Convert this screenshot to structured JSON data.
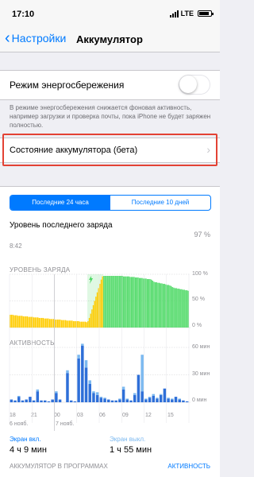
{
  "status_bar": {
    "time": "17:10",
    "network": "LTE"
  },
  "nav": {
    "back_label": "Настройки",
    "title": "Аккумулятор"
  },
  "low_power": {
    "label": "Режим энергосбережения",
    "enabled": false,
    "description": "В режиме энергосбережения снижается фоновая активность, например загрузки и проверка почты, пока iPhone не будет заряжен полностью."
  },
  "battery_health": {
    "label": "Состояние аккумулятора (бета)"
  },
  "segments": [
    {
      "label": "Последние 24 часа",
      "active": true
    },
    {
      "label": "Последние 10 дней",
      "active": false
    }
  ],
  "last_charge": {
    "title": "Уровень последнего заряда",
    "time": "8:42",
    "percent": "97 %"
  },
  "colors": {
    "accent": "#007aff",
    "highlight": "#e34234",
    "charge_green": "#4cd964",
    "charge_yellow": "#ffcc00",
    "activity_dark": "#2e6fd8",
    "activity_light": "#7cb9f0"
  },
  "chart_data": [
    {
      "type": "bar",
      "title": "УРОВЕНЬ ЗАРЯДА",
      "y_ticks": [
        "100 %",
        "50 %",
        "0 %"
      ],
      "ylim": [
        0,
        100
      ],
      "series": [
        {
          "values": [
            24,
            24,
            24,
            23,
            23,
            23,
            22,
            22,
            22,
            22,
            21,
            21,
            21,
            21,
            20,
            20,
            20,
            20,
            19,
            19,
            19,
            19,
            18,
            18,
            18,
            18,
            17,
            17,
            17,
            17,
            16,
            16,
            16,
            16,
            15,
            15,
            15,
            15,
            15,
            14,
            14,
            14,
            14,
            13,
            13,
            13,
            13,
            13,
            12,
            12,
            12,
            12,
            12,
            11,
            11,
            11,
            11,
            11,
            10,
            12,
            18,
            26,
            34,
            42,
            50,
            58,
            66,
            74,
            82,
            90,
            96,
            97,
            97,
            97,
            97,
            97,
            97,
            97,
            97,
            97,
            97,
            97,
            97,
            97,
            97,
            97,
            96,
            96,
            96,
            96,
            96,
            95,
            95,
            95,
            95,
            94,
            94,
            94,
            93,
            93,
            93,
            92,
            92,
            92,
            91,
            91,
            91,
            90,
            88,
            86,
            85,
            85,
            84,
            84,
            83,
            83,
            82,
            82,
            81,
            80,
            80,
            79,
            78,
            76,
            75,
            74,
            74,
            73,
            73,
            72,
            72,
            71,
            71,
            70,
            70,
            69
          ]
        }
      ],
      "charging_markers": [
        "charging-bolt"
      ]
    },
    {
      "type": "bar",
      "title": "АКТИВНОСТЬ",
      "y_ticks": [
        "60 мин",
        "30 мин",
        "0 мин"
      ],
      "ylim": [
        0,
        60
      ],
      "x_ticks": [
        "18",
        "21",
        "00",
        "03",
        "06",
        "09",
        "12",
        "15"
      ],
      "date_labels": [
        "6 нояб.",
        "7 нояб."
      ],
      "series": [
        {
          "name": "Экран вкл.",
          "values": [
            3,
            2,
            6,
            2,
            3,
            6,
            2,
            12,
            2,
            2,
            1,
            3,
            10,
            3,
            0,
            32,
            2,
            1,
            48,
            62,
            38,
            20,
            10,
            8,
            5,
            4,
            3,
            2,
            2,
            3,
            14,
            3,
            2,
            8,
            30,
            12,
            3,
            5,
            7,
            4,
            8,
            15,
            4,
            3,
            6,
            3,
            2,
            1
          ]
        },
        {
          "name": "Экран выкл.",
          "values": [
            0,
            0,
            1,
            0,
            0,
            0,
            0,
            2,
            0,
            0,
            0,
            0,
            2,
            0,
            0,
            3,
            0,
            0,
            4,
            2,
            8,
            4,
            2,
            3,
            1,
            1,
            0,
            0,
            0,
            1,
            3,
            1,
            0,
            2,
            0,
            40,
            1,
            1,
            2,
            1,
            1,
            0,
            1,
            1,
            0,
            1,
            0,
            0
          ]
        }
      ]
    }
  ],
  "stats": [
    {
      "label": "Экран вкл.",
      "value": "4 ч 9 мин"
    },
    {
      "label": "Экран выкл.",
      "value": "1 ч 55 мин"
    }
  ],
  "footer": {
    "label": "АККУМУЛЯТОР В ПРОГРАММАХ",
    "action": "АКТИВНОСТЬ"
  }
}
